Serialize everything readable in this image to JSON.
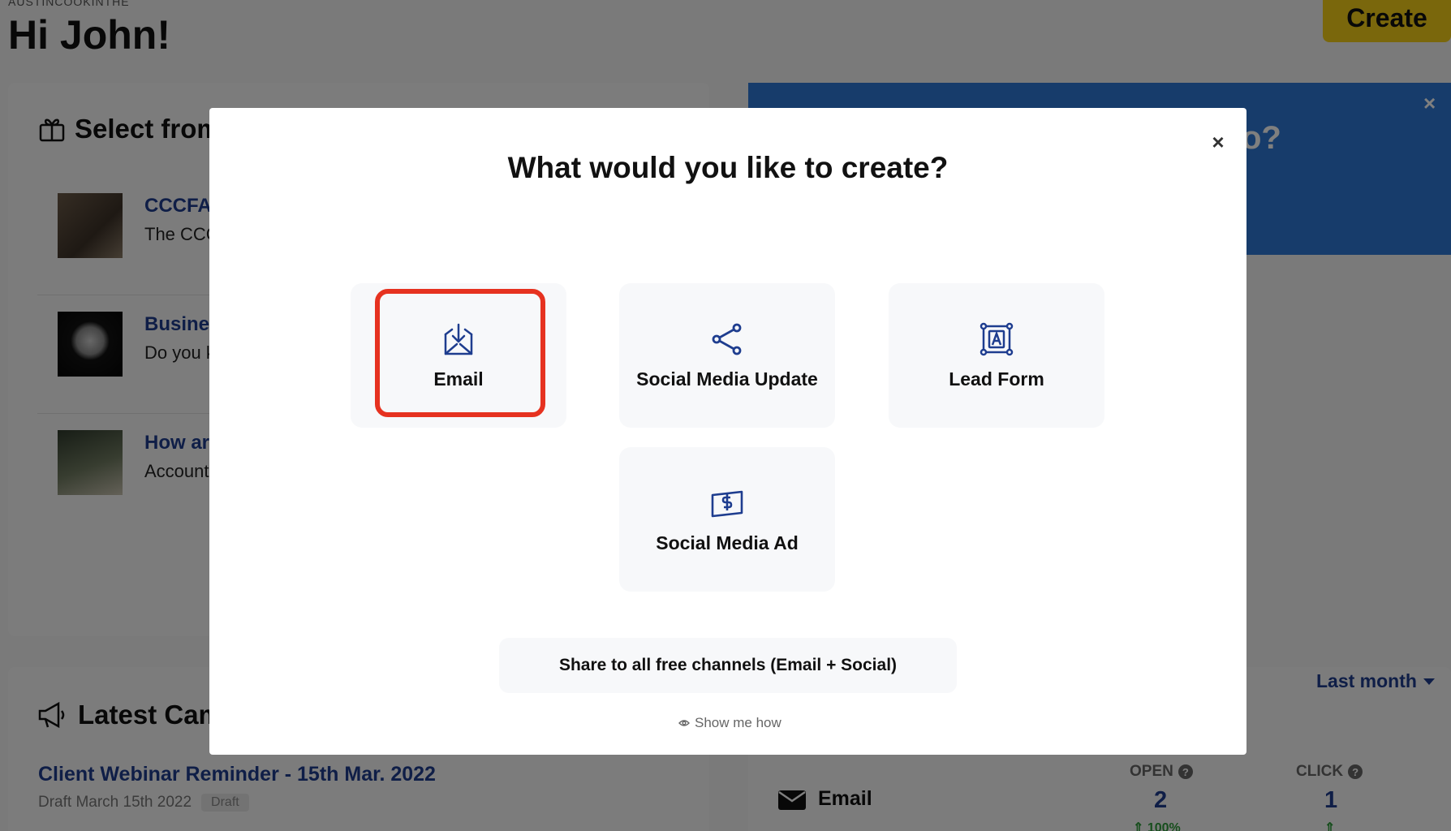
{
  "page": {
    "top_small_text": "AUSTINCOOKINTHE",
    "greeting": "Hi John!",
    "create_label": "Create"
  },
  "select_card": {
    "title": "Select from",
    "articles": [
      {
        "title": "CCCFA",
        "subtitle": "The CCC",
        "thumb_color": "#5a4a3c"
      },
      {
        "title": "Busine",
        "subtitle": "Do you k",
        "thumb_color": "#111111"
      },
      {
        "title": "How ar",
        "subtitle": "Account",
        "thumb_color": "#4d5a4a"
      }
    ]
  },
  "blue_banner": {
    "partial_text": "o?",
    "close_label": "×"
  },
  "latest_card": {
    "title": "Latest Cam",
    "campaign_title": "Client Webinar Reminder - 15th Mar. 2022",
    "campaign_meta": "Draft March 15th 2022",
    "badge": "Draft"
  },
  "stats": {
    "period": "Last month",
    "channel": "Email",
    "open_label": "OPEN",
    "open_value": "2",
    "open_change": "100%",
    "click_label": "CLICK",
    "click_value": "1"
  },
  "modal": {
    "title": "What would you like to create?",
    "close_label": "×",
    "options": [
      {
        "label": "Email",
        "icon": "email-download-icon"
      },
      {
        "label": "Social Media Update",
        "icon": "share-icon"
      },
      {
        "label": "Lead Form",
        "icon": "lead-form-icon"
      },
      {
        "label": "Social Media Ad",
        "icon": "dollar-bill-icon"
      }
    ],
    "share_label": "Share to all free channels (Email + Social)",
    "show_how_label": "Show me how",
    "accent_color": "#1e3d8f",
    "highlight_color": "#e63220"
  }
}
